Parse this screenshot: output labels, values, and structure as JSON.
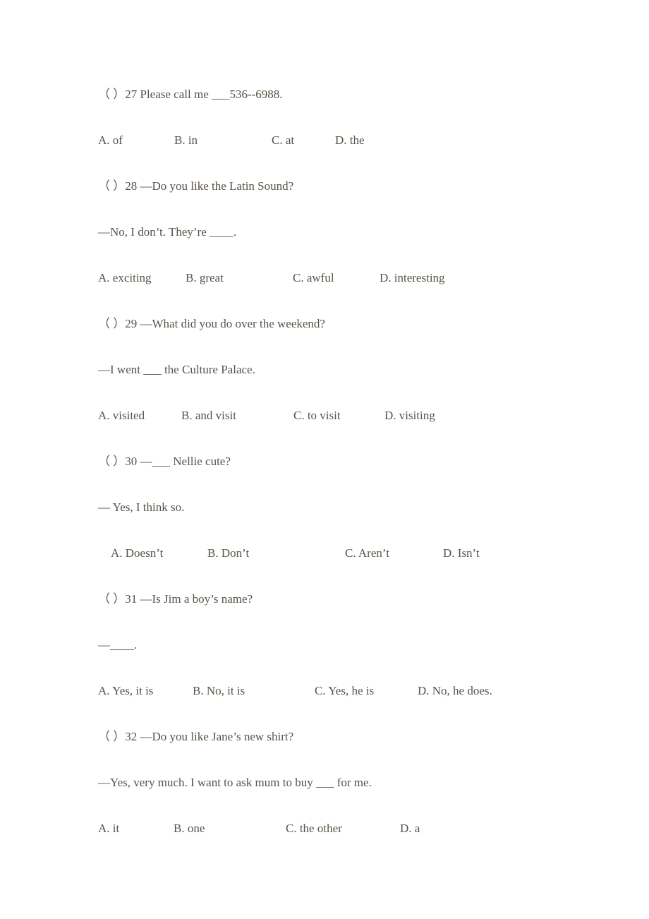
{
  "questions": [
    {
      "number": "27",
      "stem": "（ ）27 Please call me ___536--6988.",
      "reply": null,
      "options": [
        "A. of",
        "B. in",
        "C. at",
        "D. the"
      ]
    },
    {
      "number": "28",
      "stem": "（ ）28 —Do you like the Latin Sound?",
      "reply": "—No, I don’t. They’re ____.",
      "options": [
        "A. exciting",
        "B. great",
        "C. awful",
        "D. interesting"
      ]
    },
    {
      "number": "29",
      "stem": "（ ）29 —What did you do over the weekend?",
      "reply": "—I went ___ the Culture Palace.",
      "options": [
        "A. visited",
        "B. and visit",
        "C. to visit",
        "D. visiting"
      ]
    },
    {
      "number": "30",
      "stem": "（ ）30 —___ Nellie cute?",
      "reply": "— Yes, I think so.",
      "options": [
        "A. Doesn’t",
        "B. Don’t",
        "C. Aren’t",
        "D. Isn’t"
      ]
    },
    {
      "number": "31",
      "stem": "（ ）31 —Is Jim a boy’s name?",
      "reply": "—____.",
      "options": [
        "A. Yes, it is",
        "B. No, it is",
        "C. Yes, he is",
        "D. No, he does."
      ]
    },
    {
      "number": "32",
      "stem": "（ ）32 —Do you like Jane’s new shirt?",
      "reply": "—Yes, very much. I want to ask mum to buy ___ for me.",
      "options": [
        "A. it",
        "B. one",
        "C. the other",
        "D. a"
      ]
    }
  ]
}
